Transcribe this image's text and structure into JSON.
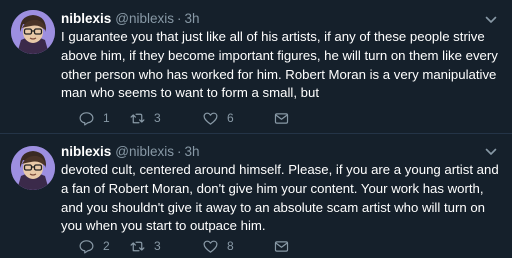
{
  "tweets": [
    {
      "name": "niblexis",
      "handle": "@niblexis",
      "separator": "·",
      "time": "3h",
      "text": "I guarantee you that just like all of his artists, if any of these people strive above him, if they become important figures, he will turn on them like every other person who has worked for him. Robert Moran is a very manipulative man who seems to want to form a small, but",
      "replies": "1",
      "retweets": "3",
      "likes": "6"
    },
    {
      "name": "niblexis",
      "handle": "@niblexis",
      "separator": "·",
      "time": "3h",
      "text": "devoted cult, centered around himself. Please, if you are a young artist and a fan of Robert Moran, don't give him your content. Your work has worth, and you shouldn't give it away to an absolute scam artist who will turn on you when you start to outpace him.",
      "replies": "2",
      "retweets": "3",
      "likes": "8"
    }
  ],
  "colors": {
    "background": "#15202b",
    "text": "#ffffff",
    "secondary": "#8899a6",
    "divider": "#243447"
  },
  "icons": [
    "chevron-down-icon",
    "reply-icon",
    "retweet-icon",
    "like-icon",
    "direct-message-icon"
  ]
}
